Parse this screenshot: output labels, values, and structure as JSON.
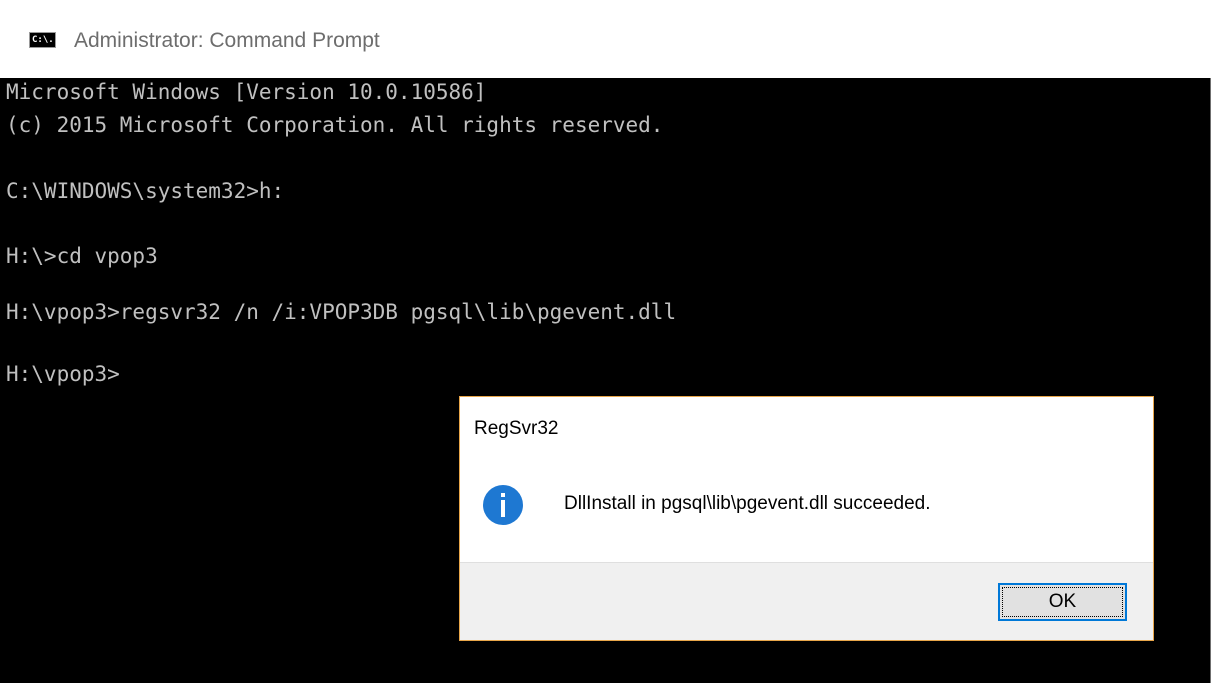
{
  "window": {
    "title": "Administrator: Command Prompt",
    "icon_label": "C:\\.",
    "icon": "cmd-icon"
  },
  "console": {
    "lines": [
      "Microsoft Windows [Version 10.0.10586]",
      "(c) 2015 Microsoft Corporation. All rights reserved.",
      "",
      "C:\\WINDOWS\\system32>h:",
      "",
      "H:\\>cd vpop3",
      "",
      "H:\\vpop3>regsvr32 /n /i:VPOP3DB pgsql\\lib\\pgevent.dll",
      "",
      "H:\\vpop3>"
    ]
  },
  "dialog": {
    "title": "RegSvr32",
    "icon": "info-icon",
    "message": "DllInstall in pgsql\\lib\\pgevent.dll succeeded.",
    "ok_label": "OK"
  },
  "colors": {
    "console_bg": "#000000",
    "console_text": "#c0c0c0",
    "info_icon": "#1e78d2",
    "button_focus": "#0078d7"
  }
}
